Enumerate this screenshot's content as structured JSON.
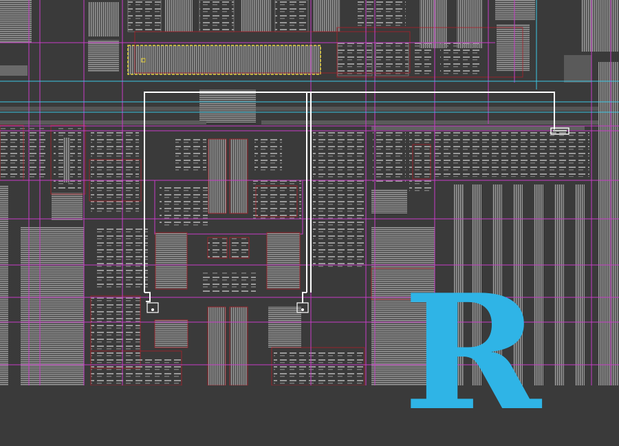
{
  "view": {
    "kind": "chip-layout-micrograph",
    "overlay_letter": "R"
  },
  "colors": {
    "substrate": "#3a3a3a",
    "metal_block": "#8c8c8c",
    "metal_light": "#b5b5b5",
    "cell_outline": "#b0202a",
    "grid_magenta": "#c83cc8",
    "grid_cyan": "#3cc8e6",
    "route_white": "#ffffff",
    "highlight_yellow": "#e6d23c",
    "letter_blue": "#2fb4e6"
  }
}
